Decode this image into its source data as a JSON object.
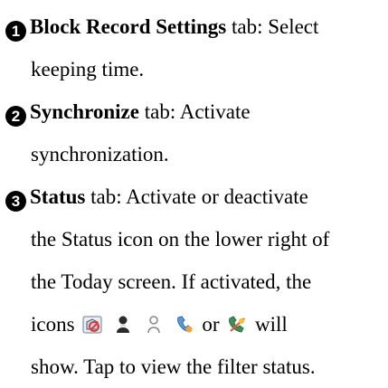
{
  "items": [
    {
      "number": "1",
      "tab_name": "Block Record Settings",
      "line1_rest": " tab: Select",
      "line2": "keeping time."
    },
    {
      "number": "2",
      "tab_name": "Synchronize",
      "line1_rest": " tab: Activate",
      "line2": "synchronization."
    },
    {
      "number": "3",
      "tab_name": "Status",
      "line1_rest": " tab: Activate or deactivate",
      "line2": "the Status icon on the lower right of",
      "line3": "the Today screen. If activated, the",
      "line4_start": "icons",
      "line4_or": "or",
      "line4_end": "will",
      "line5": "show. Tap to view the filter status."
    }
  ],
  "status_icons": [
    "blocked-call-icon",
    "person-icon",
    "person-outline-icon",
    "phone-handset-icon",
    "blocked-phone-icon"
  ]
}
